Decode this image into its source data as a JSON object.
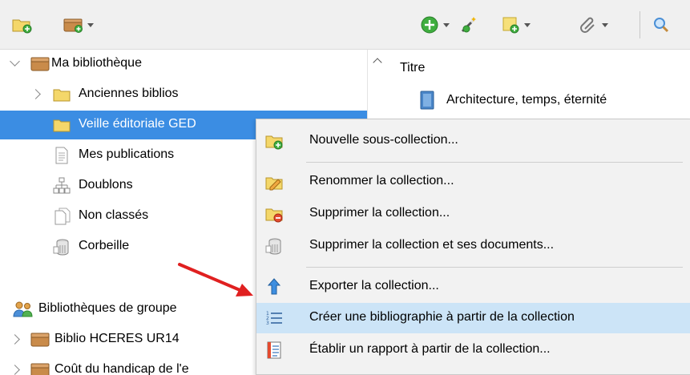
{
  "toolbar": {
    "icons": [
      "new-collection-icon",
      "new-library-icon",
      "new-item-icon",
      "add-by-identifier-icon",
      "new-note-icon",
      "attachment-icon",
      "search-icon"
    ]
  },
  "library": {
    "root": "Ma bibliothèque",
    "items": [
      {
        "label": "Anciennes biblios",
        "icon": "folder-icon"
      },
      {
        "label": "Veille éditoriale GED",
        "icon": "folder-icon",
        "selected": true
      },
      {
        "label": "Mes publications",
        "icon": "document-icon"
      },
      {
        "label": "Doublons",
        "icon": "duplicates-icon"
      },
      {
        "label": "Non classés",
        "icon": "unfiled-icon"
      },
      {
        "label": "Corbeille",
        "icon": "trash-icon"
      }
    ],
    "groups_header": "Bibliothèques de groupe",
    "groups": [
      {
        "label": "Biblio HCERES UR14"
      },
      {
        "label": "Coût du handicap de l'e"
      }
    ]
  },
  "items_pane": {
    "column_title": "Titre",
    "items": [
      {
        "label": "Architecture, temps, éternité"
      }
    ]
  },
  "context_menu": {
    "items": [
      {
        "label": "Nouvelle sous-collection...",
        "icon": "new-subcollection-icon"
      },
      {
        "label": "Renommer la collection...",
        "icon": "rename-icon"
      },
      {
        "label": "Supprimer la collection...",
        "icon": "delete-collection-icon"
      },
      {
        "label": "Supprimer la collection et ses documents...",
        "icon": "delete-with-items-icon"
      },
      {
        "label": "Exporter la collection...",
        "icon": "export-icon"
      },
      {
        "label": "Créer une bibliographie à partir de la collection",
        "icon": "bibliography-icon",
        "highlighted": true
      },
      {
        "label": "Établir un rapport à partir de la collection...",
        "icon": "report-icon"
      }
    ]
  },
  "colors": {
    "selection": "#3b8de3",
    "menu_highlight": "#cce4f7",
    "arrow": "#e02020"
  }
}
